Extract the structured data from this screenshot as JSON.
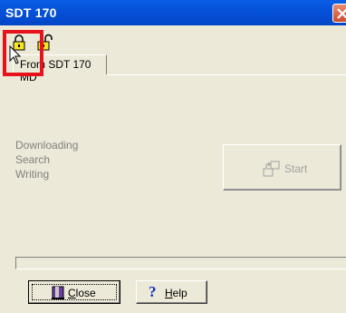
{
  "window": {
    "title": "SDT 170",
    "close_icon": "close-x-icon"
  },
  "toolbar": {
    "buttons": [
      {
        "icon": "lock-yellow-icon"
      },
      {
        "icon": "unlock-icon"
      }
    ]
  },
  "tabs": [
    {
      "label": "From SDT 170 MD",
      "active": true
    }
  ],
  "status": {
    "downloading": "Downloading",
    "search": "Search",
    "writing": "Writing"
  },
  "start_button": {
    "label": "Start",
    "enabled": false,
    "icon": "start-transfer-icon"
  },
  "footer": {
    "close_label": "Close",
    "close_accel": "C",
    "close_rest": "lose",
    "help_label": "Help",
    "help_accel": "H",
    "help_rest": "elp",
    "close_icon": "door-icon",
    "help_icon": "question-mark-icon"
  },
  "colors": {
    "titlebar": "#0552D8",
    "face": "#ECE9D8",
    "highlight": "#E8121C"
  }
}
